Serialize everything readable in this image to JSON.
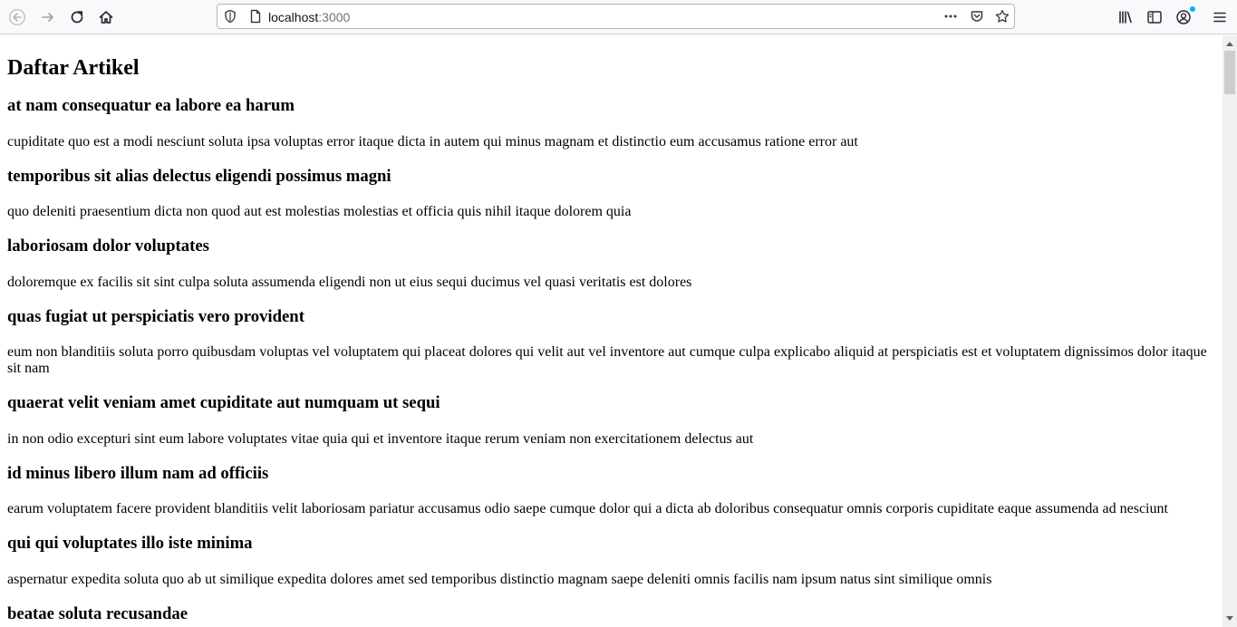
{
  "browser": {
    "url_host": "localhost",
    "url_port": ":3000",
    "icons": {
      "back": "arrow-left-icon",
      "forward": "arrow-right-icon",
      "reload": "reload-icon",
      "home": "home-icon",
      "shield": "tracking-protection-shield-icon",
      "page": "page-info-icon",
      "more": "more-actions-icon",
      "pocket": "pocket-icon",
      "bookmark": "star-icon",
      "library": "library-icon",
      "sidebar": "sidebar-icon",
      "account": "account-icon",
      "menu": "hamburger-menu-icon"
    },
    "notify_color": "#00b3f4"
  },
  "page": {
    "title": "Daftar Artikel",
    "articles": [
      {
        "title": "at nam consequatur ea labore ea harum",
        "body": "cupiditate quo est a modi nesciunt soluta ipsa voluptas error itaque dicta in autem qui minus magnam et distinctio eum accusamus ratione error aut"
      },
      {
        "title": "temporibus sit alias delectus eligendi possimus magni",
        "body": "quo deleniti praesentium dicta non quod aut est molestias molestias et officia quis nihil itaque dolorem quia"
      },
      {
        "title": "laboriosam dolor voluptates",
        "body": "doloremque ex facilis sit sint culpa soluta assumenda eligendi non ut eius sequi ducimus vel quasi veritatis est dolores"
      },
      {
        "title": "quas fugiat ut perspiciatis vero provident",
        "body": "eum non blanditiis soluta porro quibusdam voluptas vel voluptatem qui placeat dolores qui velit aut vel inventore aut cumque culpa explicabo aliquid at perspiciatis est et voluptatem dignissimos dolor itaque sit nam"
      },
      {
        "title": "quaerat velit veniam amet cupiditate aut numquam ut sequi",
        "body": "in non odio excepturi sint eum labore voluptates vitae quia qui et inventore itaque rerum veniam non exercitationem delectus aut"
      },
      {
        "title": "id minus libero illum nam ad officiis",
        "body": "earum voluptatem facere provident blanditiis velit laboriosam pariatur accusamus odio saepe cumque dolor qui a dicta ab doloribus consequatur omnis corporis cupiditate eaque assumenda ad nesciunt"
      },
      {
        "title": "qui qui voluptates illo iste minima",
        "body": "aspernatur expedita soluta quo ab ut similique expedita dolores amet sed temporibus distinctio magnam saepe deleniti omnis facilis nam ipsum natus sint similique omnis"
      },
      {
        "title": "beatae soluta recusandae",
        "body": ""
      }
    ]
  }
}
